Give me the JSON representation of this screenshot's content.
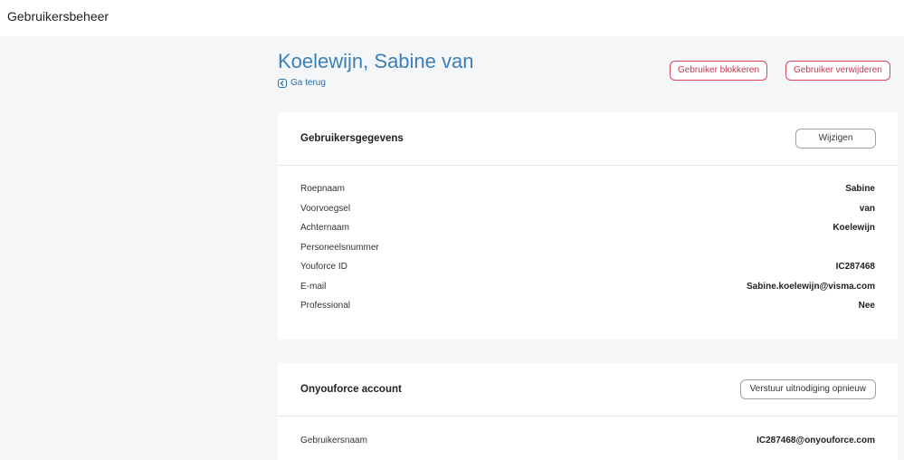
{
  "app": {
    "title": "Gebruikersbeheer"
  },
  "header": {
    "user_name": "Koelewijn, Sabine van",
    "back_label": "Ga terug",
    "block_button": "Gebruiker blokkeren",
    "delete_button": "Gebruiker verwijderen"
  },
  "details_card": {
    "title": "Gebruikersgegevens",
    "edit_button": "Wijzigen",
    "rows": [
      {
        "label": "Roepnaam",
        "value": "Sabine"
      },
      {
        "label": "Voorvoegsel",
        "value": "van"
      },
      {
        "label": "Achternaam",
        "value": "Koelewijn"
      },
      {
        "label": "Personeelsnummer",
        "value": ""
      },
      {
        "label": "Youforce ID",
        "value": "IC287468"
      },
      {
        "label": "E-mail",
        "value": "Sabine.koelewijn@visma.com"
      },
      {
        "label": "Professional",
        "value": "Nee"
      }
    ]
  },
  "account_card": {
    "title": "Onyouforce account",
    "resend_button": "Verstuur uitnodiging opnieuw",
    "rows": [
      {
        "label": "Gebruikersnaam",
        "value": "IC287468@onyouforce.com"
      }
    ]
  },
  "colors": {
    "accent": "#3d7fb8",
    "danger": "#d9455a",
    "background": "#f4f6f8"
  }
}
